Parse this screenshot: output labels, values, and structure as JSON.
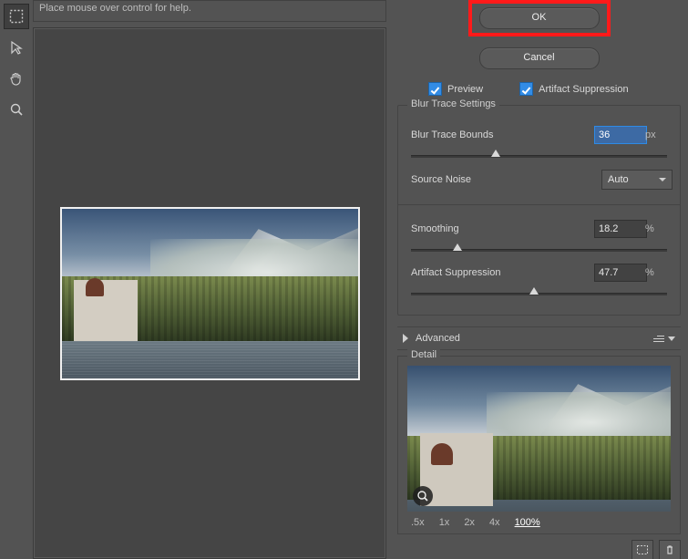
{
  "help_text": "Place mouse over control for help.",
  "buttons": {
    "ok": "OK",
    "cancel": "Cancel"
  },
  "checks": {
    "preview": "Preview",
    "artifact": "Artifact Suppression"
  },
  "group_trace": {
    "title": "Blur Trace Settings",
    "bounds": {
      "label": "Blur Trace Bounds",
      "value": "36",
      "unit": "px",
      "pos": 33
    },
    "noise": {
      "label": "Source Noise",
      "value": "Auto"
    },
    "smooth": {
      "label": "Smoothing",
      "value": "18.2",
      "unit": "%",
      "pos": 18
    },
    "suppr": {
      "label": "Artifact Suppression",
      "value": "47.7",
      "unit": "%",
      "pos": 48
    }
  },
  "advanced": {
    "label": "Advanced"
  },
  "detail": {
    "title": "Detail",
    "zoom": [
      ".5x",
      "1x",
      "2x",
      "4x",
      "100%"
    ]
  }
}
